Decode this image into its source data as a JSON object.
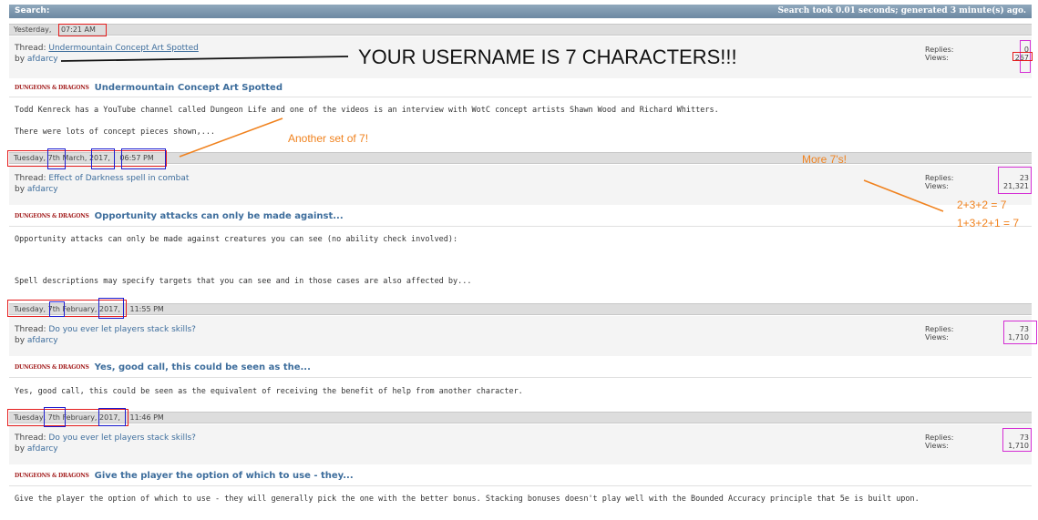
{
  "header": {
    "title": "Search:",
    "meta": "Search took 0.01 seconds; generated 3 minute(s) ago."
  },
  "results": [
    {
      "date_prefix": "Yesterday,",
      "time": "07:21 AM",
      "thread_label": "Thread:",
      "thread_title": "Undermountain Concept Art Spotted",
      "by_label": "by",
      "username": "afdarcy",
      "replies_label": "Replies:",
      "views_label": "Views:",
      "replies": "0",
      "views": "267",
      "logo_text": "DUNGEONS & DRAGONS",
      "post_title": "Undermountain Concept Art Spotted",
      "excerpt_lines": [
        "Todd Kenreck has a YouTube channel called Dungeon Life and one of the videos is an interview with WotC concept artists Shawn Wood and Richard Whitters.",
        "There were lots of concept pieces shown,..."
      ]
    },
    {
      "date_prefix": "Tuesday,",
      "day": "7th",
      "month": "March,",
      "year": "2017,",
      "time": "06:57 PM",
      "thread_label": "Thread:",
      "thread_title": "Effect of Darkness spell in combat",
      "by_label": "by",
      "username": "afdarcy",
      "replies_label": "Replies:",
      "views_label": "Views:",
      "replies": "23",
      "views": "21,321",
      "logo_text": "DUNGEONS & DRAGONS",
      "post_title": "Opportunity attacks can only be made against...",
      "excerpt_lines": [
        "Opportunity attacks can only be made against creatures you can see (no ability check involved):",
        "Spell descriptions may specify targets that you can see and in those cases are also affected by..."
      ]
    },
    {
      "date_prefix": "Tuesday,",
      "day": "7th",
      "month": "February,",
      "year": "2017,",
      "time": "11:55 PM",
      "thread_label": "Thread:",
      "thread_title": "Do you ever let players stack skills?",
      "by_label": "by",
      "username": "afdarcy",
      "replies_label": "Replies:",
      "views_label": "Views:",
      "replies": "73",
      "views": "1,710",
      "logo_text": "DUNGEONS & DRAGONS",
      "post_title": "Yes, good call, this could be seen as the...",
      "excerpt_lines": [
        "Yes, good call, this could be seen as the equivalent of receiving the benefit of help from another character."
      ]
    },
    {
      "date_prefix": "Tuesday,",
      "day": "7th",
      "month": "February,",
      "year": "2017,",
      "time": "11:46 PM",
      "thread_label": "Thread:",
      "thread_title": "Do you ever let players stack skills?",
      "by_label": "by",
      "username": "afdarcy",
      "replies_label": "Replies:",
      "views_label": "Views:",
      "replies": "73",
      "views": "1,710",
      "logo_text": "DUNGEONS & DRAGONS",
      "post_title": "Give the player the option of which to use - they...",
      "excerpt_lines": [
        "Give the player the option of which to use - they will generally pick the one with the better bonus. Stacking bonuses doesn't play well with the Bounded Accuracy principle that 5e is built upon."
      ]
    }
  ],
  "annotations": {
    "username_note": "YOUR USERNAME IS 7 CHARACTERS!!!",
    "another_set": "Another set of 7!",
    "more_sevens": "More 7's!",
    "sum1": "2+3+2 = 7",
    "sum2": "1+3+2+1 = 7"
  },
  "colors": {
    "header_bg": "#7b94ab",
    "link": "#3d6d9c",
    "annotation_red": "#e51d1d",
    "annotation_blue": "#1c1ccf",
    "annotation_magenta": "#d42ed4",
    "annotation_orange": "#f0821e"
  }
}
